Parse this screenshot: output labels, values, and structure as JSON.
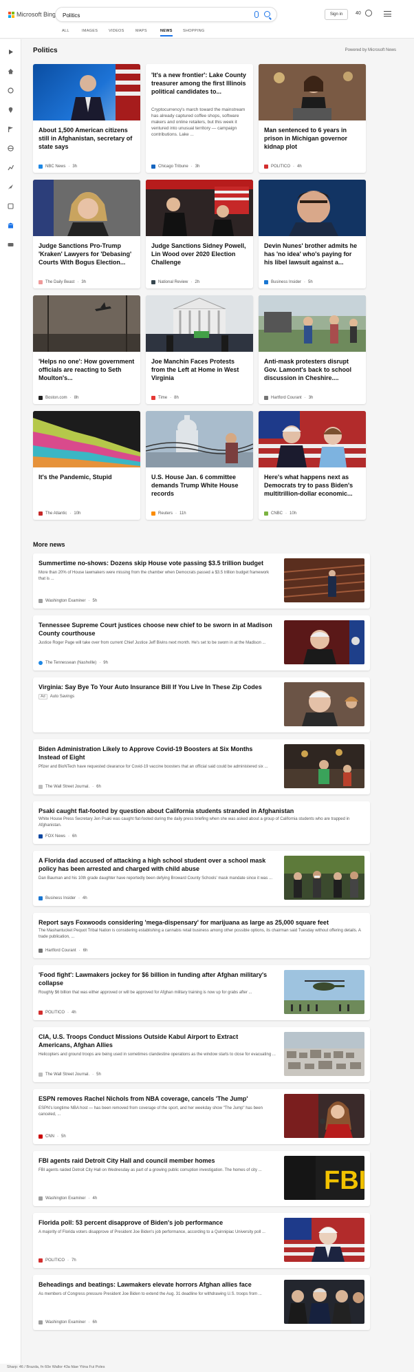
{
  "header": {
    "brand": "Microsoft Bing",
    "search_value": "Politics",
    "signin_label": "Sign in",
    "points": "40"
  },
  "tabs": [
    {
      "label": "ALL"
    },
    {
      "label": "IMAGES"
    },
    {
      "label": "VIDEOS"
    },
    {
      "label": "MAPS"
    },
    {
      "label": "NEWS",
      "active": true
    },
    {
      "label": "SHOPPING"
    }
  ],
  "section": {
    "title": "Politics",
    "powered_by": "Powered by Microsoft News"
  },
  "cards": [
    {
      "title": "About 1,500 American citizens still in Afghanistan, secretary of state says",
      "source": "NBC News",
      "age": "3h",
      "fav_color": "#1e88e5"
    },
    {
      "title": "'It's a new frontier': Lake County treasurer among the first Illinois political candidates to...",
      "snippet": "Cryptocurrency's march toward the mainstream has already captured coffee shops, software makers and online retailers, but this week it ventured into unusual territory — campaign contributions. Lake ...",
      "source": "Chicago Tribune",
      "age": "3h",
      "fav_color": "#1565c0"
    },
    {
      "title": "Man sentenced to 6 years in prison in Michigan governor kidnap plot",
      "source": "POLITICO",
      "age": "4h",
      "fav_color": "#d32f2f"
    },
    {
      "title": "Judge Sanctions Pro-Trump 'Kraken' Lawyers for 'Debasing' Courts With Bogus Election...",
      "source": "The Daily Beast",
      "age": "3h",
      "fav_color": "#ef9a9a"
    },
    {
      "title": "Judge Sanctions Sidney Powell, Lin Wood over 2020 Election Challenge",
      "source": "National Review",
      "age": "2h",
      "fav_color": "#37474f"
    },
    {
      "title": "Devin Nunes' brother admits he has 'no idea' who's paying for his libel lawsuit against a...",
      "source": "Business Insider",
      "age": "5h",
      "fav_color": "#1976d2"
    },
    {
      "title": "'Helps no one': How government officials are reacting to Seth Moulton's...",
      "source": "Boston.com",
      "age": "8h",
      "fav_color": "#212121"
    },
    {
      "title": "Joe Manchin Faces Protests from the Left at Home in West Virginia",
      "source": "Time",
      "age": "8h",
      "fav_color": "#e53935"
    },
    {
      "title": "Anti-mask protesters disrupt Gov. Lamont's back to school discussion in Cheshire....",
      "source": "Hartford Courant",
      "age": "3h",
      "fav_color": "#757575"
    },
    {
      "title": "It's the Pandemic, Stupid",
      "source": "The Atlantic",
      "age": "10h",
      "fav_color": "#c62828"
    },
    {
      "title": "U.S. House Jan. 6 committee demands Trump White House records",
      "source": "Reuters",
      "age": "11h",
      "fav_color": "#fb8c00"
    },
    {
      "title": "Here's what happens next as Democrats try to pass Biden's multitrillion-dollar economic...",
      "source": "CNBC",
      "age": "10h",
      "fav_color": "#7cb342"
    }
  ],
  "more_news": {
    "title": "More news",
    "items": [
      {
        "title": "Summertime no-shows: Dozens skip House vote passing $3.5 trillion budget",
        "snippet": "More than 20% of House lawmakers were missing from the chamber when Democrats passed a $3.5 trillion budget framework that is ...",
        "source": "Washington Examiner",
        "age": "5h",
        "fav_color": "#9e9e9e"
      },
      {
        "title": "Tennessee Supreme Court justices choose new chief to be sworn in at Madison County courthouse",
        "snippet": "Justice Roger Page will take over from current Chief Justice Jeff Bivins next month. He's set to be sworn in at the Madison ...",
        "source": "The Tennessean (Nashville)",
        "age": "9h",
        "fav_color": "#1e88e5"
      },
      {
        "title": "Virginia: Say Bye To Your Auto Insurance Bill If You Live In These Zip Codes",
        "snippet": "",
        "source": "Auto Savings",
        "age": "",
        "ad": "Ad",
        "fav_color": ""
      },
      {
        "title": "Biden Administration Likely to Approve Covid-19 Boosters at Six Months Instead of Eight",
        "snippet": "Pfizer and BioNTech have requested clearance for Covid-19 vaccine boosters that an official said could be administered six ...",
        "source": "The Wall Street Journal.",
        "age": "6h",
        "fav_color": "#bdbdbd"
      },
      {
        "title": "Psaki caught flat-footed by question about California students stranded in Afghanistan",
        "snippet": "White House Press Secretary Jen Psaki was caught flat-footed during the daily press briefing when she was asked about a group of California students who are trapped in Afghanistan.",
        "source": "FOX News",
        "age": "6h",
        "fav_color": "#0d47a1"
      },
      {
        "title": "A Florida dad accused of attacking a high school student over a school mask policy has been arrested and charged with child abuse",
        "snippet": "Dan Bauman and his 10th grade daughter have reportedly been defying Broward County Schools' mask mandate since it was ...",
        "source": "Business Insider",
        "age": "4h",
        "fav_color": "#1976d2"
      },
      {
        "title": "Report says Foxwoods considering 'mega-dispensary' for marijuana as large as 25,000 square feet",
        "snippet": "The Mashantucket Pequot Tribal Nation is considering establishing a cannabis retail business among other possible options, its chairman said Tuesday without offering details. A trade publication, ...",
        "source": "Hartford Courant",
        "age": "6h",
        "fav_color": "#757575"
      },
      {
        "title": "'Food fight': Lawmakers jockey for $6 billion in funding after Afghan military's collapse",
        "snippet": "Roughly $6 billion that was either approved or will be approved for Afghan military training is now up for grabs after ...",
        "source": "POLITICO",
        "age": "4h",
        "fav_color": "#d32f2f"
      },
      {
        "title": "CIA, U.S. Troops Conduct Missions Outside Kabul Airport to Extract Americans, Afghan Allies",
        "snippet": "Helicopters and ground troops are being used in sometimes clandestine operations as the window starts to close for evacuating ...",
        "source": "The Wall Street Journal.",
        "age": "5h",
        "fav_color": "#bdbdbd"
      },
      {
        "title": "ESPN removes Rachel Nichols from NBA coverage, cancels 'The Jump'",
        "snippet": "ESPN's longtime NBA host — has been removed from coverage of the sport, and her weekday show \"The Jump\" has been canceled, ...",
        "source": "CNN",
        "age": "5h",
        "fav_color": "#cc0000"
      },
      {
        "title": "FBI agents raid Detroit City Hall and council member homes",
        "snippet": "FBI agents raided Detroit City Hall on Wednesday as part of a growing public corruption investigation. The homes of city ...",
        "source": "Washington Examiner",
        "age": "4h",
        "fav_color": "#9e9e9e"
      },
      {
        "title": "Florida poll: 53 percent disapprove of Biden's job performance",
        "snippet": "A majority of Florida voters disapprove of President Joe Biden's job performance, according to a Quinnipiac University poll ...",
        "source": "POLITICO",
        "age": "7h",
        "fav_color": "#d32f2f"
      },
      {
        "title": "Beheadings and beatings: Lawmakers elevate horrors Afghan allies face",
        "snippet": "As members of Congress pressure President Joe Biden to extend the Aug. 31 deadline for withdrawing U.S. troops from ...",
        "source": "Washington Examiner",
        "age": "6h",
        "fav_color": "#9e9e9e"
      }
    ]
  },
  "footer": {
    "left": "Sharp: 46 / Brazda, fn 60e Wallor 43a fdae Ytina Fui Poles"
  }
}
